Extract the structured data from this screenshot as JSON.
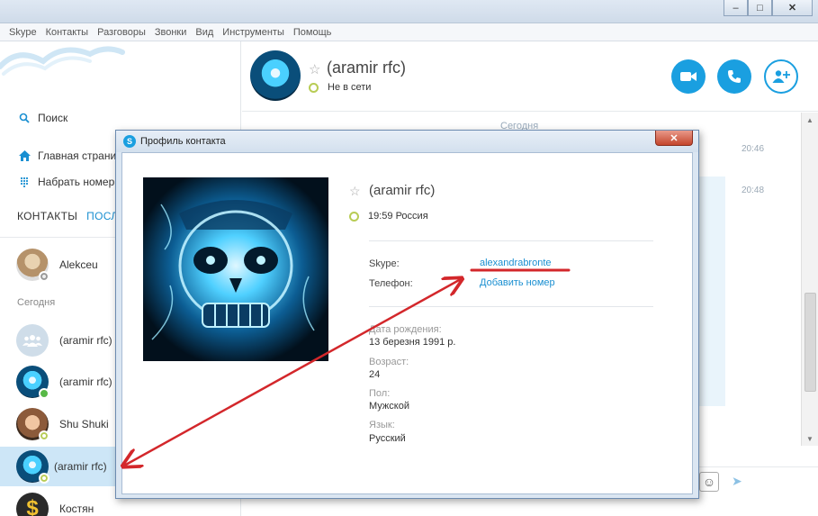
{
  "window": {
    "minimize": "–",
    "maximize": "□",
    "close": "✕"
  },
  "menu": [
    "Skype",
    "Контакты",
    "Разговоры",
    "Звонки",
    "Вид",
    "Инструменты",
    "Помощь"
  ],
  "sidebar": {
    "search": "Поиск",
    "home": "Главная страни",
    "dial": "Набрать номер",
    "tab_contacts": "КОНТАКТЫ",
    "tab_recent": "ПОСЛ",
    "today": "Сегодня",
    "contacts": [
      {
        "name": "Alekceu"
      },
      {
        "name": "(aramir rfc)"
      },
      {
        "name": "(aramir rfc)"
      },
      {
        "name": "Shu Shuki"
      },
      {
        "name": "(aramir rfc)"
      },
      {
        "name": "Костян"
      }
    ]
  },
  "header": {
    "name": "(aramir rfc)",
    "status": "Не в сети"
  },
  "chat": {
    "today": "Сегодня",
    "time1": "20:46",
    "time2": "20:48"
  },
  "dialog": {
    "title": "Профиль контакта",
    "close": "✕",
    "name": "(aramir rfc)",
    "local_time": "19:59 Россия",
    "skype_label": "Skype:",
    "skype_value": "alexandrabronte",
    "phone_label": "Телефон:",
    "phone_value": "Добавить номер",
    "birthday_label": "Дата рождения:",
    "birthday_value": "13 березня 1991 р.",
    "age_label": "Возраст:",
    "age_value": "24",
    "sex_label": "Пол:",
    "sex_value": "Мужской",
    "lang_label": "Язык:",
    "lang_value": "Русский"
  },
  "colors": {
    "accent": "#1a9fe0",
    "annotation": "#d3272b",
    "selected": "#cde6f7"
  }
}
